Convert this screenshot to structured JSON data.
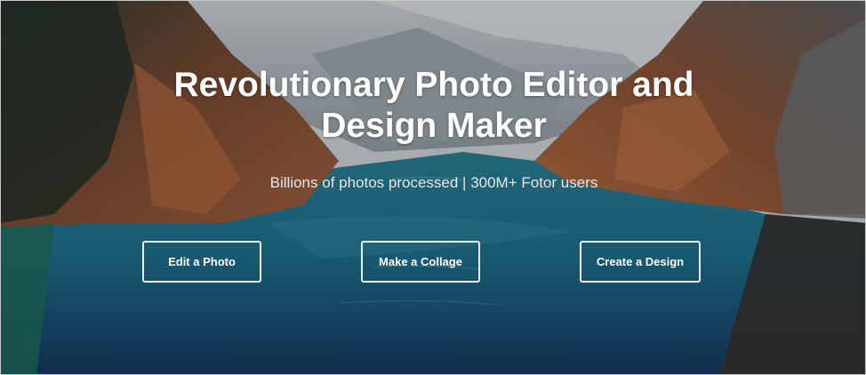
{
  "hero": {
    "headline_line1": "Revolutionary Photo Editor and",
    "headline_line2": "Design Maker",
    "subheadline": "Billions of photos processed | 300M+ Fotor users"
  },
  "actions": {
    "edit_photo_label": "Edit a Photo",
    "make_collage_label": "Make a Collage",
    "create_design_label": "Create a Design"
  },
  "colors": {
    "water_teal": "#1f7b94",
    "water_deep": "#15355e",
    "cliff_rust": "#9a5a3a",
    "gray_panel": "#2f2f2f"
  }
}
